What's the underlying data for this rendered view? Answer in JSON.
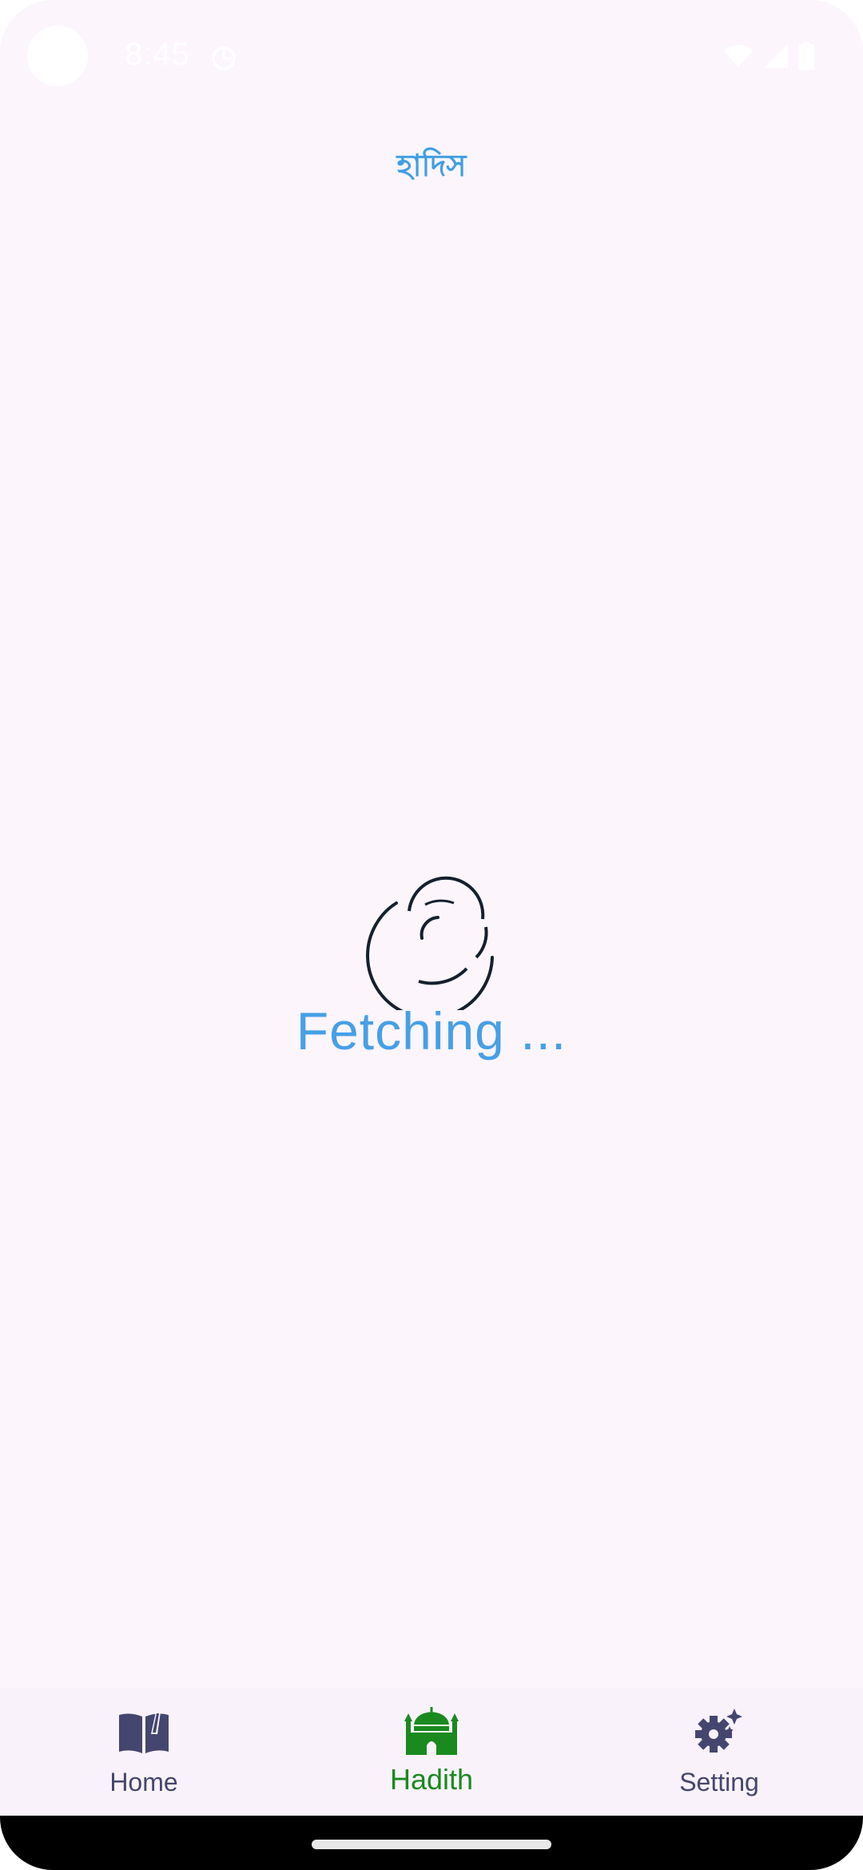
{
  "status_bar": {
    "time": "8:45",
    "icons": [
      "sync-icon",
      "wifi-icon",
      "signal-icon",
      "battery-icon"
    ]
  },
  "header": {
    "title": "হাদিস"
  },
  "main": {
    "loading_text": "Fetching ...",
    "loader_icon": "spinner-icon"
  },
  "bottom_nav": {
    "items": [
      {
        "label": "Home",
        "icon": "open-book-icon",
        "active": false
      },
      {
        "label": "Hadith",
        "icon": "mosque-icon",
        "active": true
      },
      {
        "label": "Setting",
        "icon": "gear-sparkle-icon",
        "active": false
      }
    ]
  },
  "colors": {
    "background": "#fcf5fc",
    "title": "#3f9ee4",
    "loading_text": "#46a0e6",
    "nav_active": "#1a8a1f",
    "nav_inactive": "#45466f"
  }
}
